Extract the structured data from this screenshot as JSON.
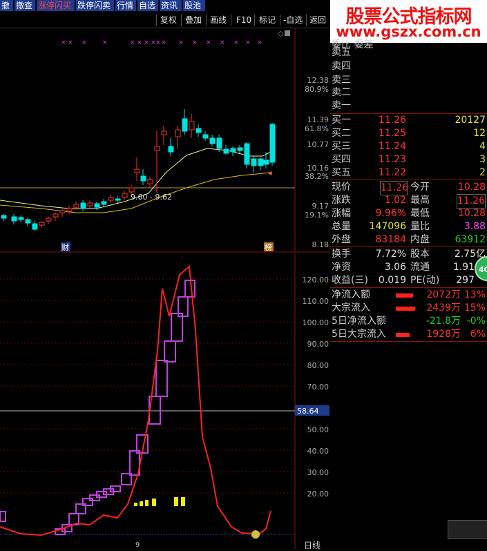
{
  "toolbar": {
    "buttons": [
      "撤",
      "撤查",
      "涨停闪买",
      "跌停闪卖",
      "行情",
      "自选",
      "资讯",
      "股池"
    ]
  },
  "toolbar2": {
    "items": [
      "复权",
      "叠加",
      "画线",
      "F10",
      "标记",
      "-自选",
      "返回"
    ]
  },
  "watermark": {
    "line1": "股票公式指标网",
    "line2": "www.gszx.com.cn"
  },
  "kline": {
    "price_ticks": [
      "12.38",
      "80.9%",
      "11.39",
      "61.8%",
      "10.77",
      "10.16",
      "38.2%",
      "9.17",
      "19.1%",
      "8.18"
    ],
    "ma_label": "9.60 - 9.62",
    "event_labels": [
      "财",
      "榜"
    ]
  },
  "indicator": {
    "ticks": [
      "120.00",
      "110.00",
      "100.00",
      "90.00",
      "80.00",
      "70.00",
      "60.00",
      "50.00",
      "40.00",
      "30.00",
      "20.00"
    ],
    "ref_value": "58.64",
    "axis_tick": "9",
    "period_label": "日线"
  },
  "orderbook": {
    "header": "委比 委差",
    "sell": [
      {
        "label": "卖五"
      },
      {
        "label": "卖四"
      },
      {
        "label": "卖三"
      },
      {
        "label": "卖二"
      },
      {
        "label": "卖一"
      }
    ],
    "buy": [
      {
        "label": "买一",
        "price": "11.26",
        "vol": "20127"
      },
      {
        "label": "买二",
        "price": "11.25",
        "vol": "12"
      },
      {
        "label": "买三",
        "price": "11.24",
        "vol": "4"
      },
      {
        "label": "买四",
        "price": "11.23",
        "vol": "3"
      },
      {
        "label": "买五",
        "price": "11.22",
        "vol": "2"
      }
    ]
  },
  "quote": {
    "now_l": "现价",
    "now_v": "11.26",
    "open_l": "今开",
    "open_v": "10.28",
    "chg_l": "涨跌",
    "chg_v": "1.02",
    "high_l": "最高",
    "high_v": "11.26",
    "pct_l": "涨幅",
    "pct_v": "9.96%",
    "low_l": "最低",
    "low_v": "10.28",
    "vol_l": "总量",
    "vol_v": "147096",
    "vr_l": "量比",
    "vr_v": "3.88",
    "out_l": "外盘",
    "out_v": "83184",
    "in_l": "内盘",
    "in_v": "63912",
    "turn_l": "换手",
    "turn_v": "7.72%",
    "cap_l": "股本",
    "cap_v": "2.75亿",
    "na_l": "净资",
    "na_v": "3.06",
    "flt_l": "流通",
    "flt_v": "1.91",
    "eps_l": "收益(三)",
    "eps_v": "0.019",
    "pe_l": "PE(动)",
    "pe_v": "297"
  },
  "flows": [
    {
      "label": "净流入额",
      "amount": "2072万",
      "pct": "13%",
      "sign": "pos",
      "bar": 0.45
    },
    {
      "label": "大宗流入",
      "amount": "2439万",
      "pct": "15%",
      "sign": "pos",
      "bar": 0.5
    },
    {
      "label": "5日净流入额",
      "amount": "-21.8万",
      "pct": "-0%",
      "sign": "neg",
      "bar": 0.0
    },
    {
      "label": "5日大宗流入",
      "amount": "1928万",
      "pct": "6%",
      "sign": "pos",
      "bar": 0.35
    }
  ],
  "badge": {
    "text": "40"
  },
  "colors": {
    "up": "#ff3030",
    "down": "#00e0e0",
    "ma1": "#f0f0a0",
    "ma2": "#e0c000",
    "indicator_line": "#ff2020",
    "box": "#c040e0",
    "toolbar_bg": "#1e3a8c"
  }
}
